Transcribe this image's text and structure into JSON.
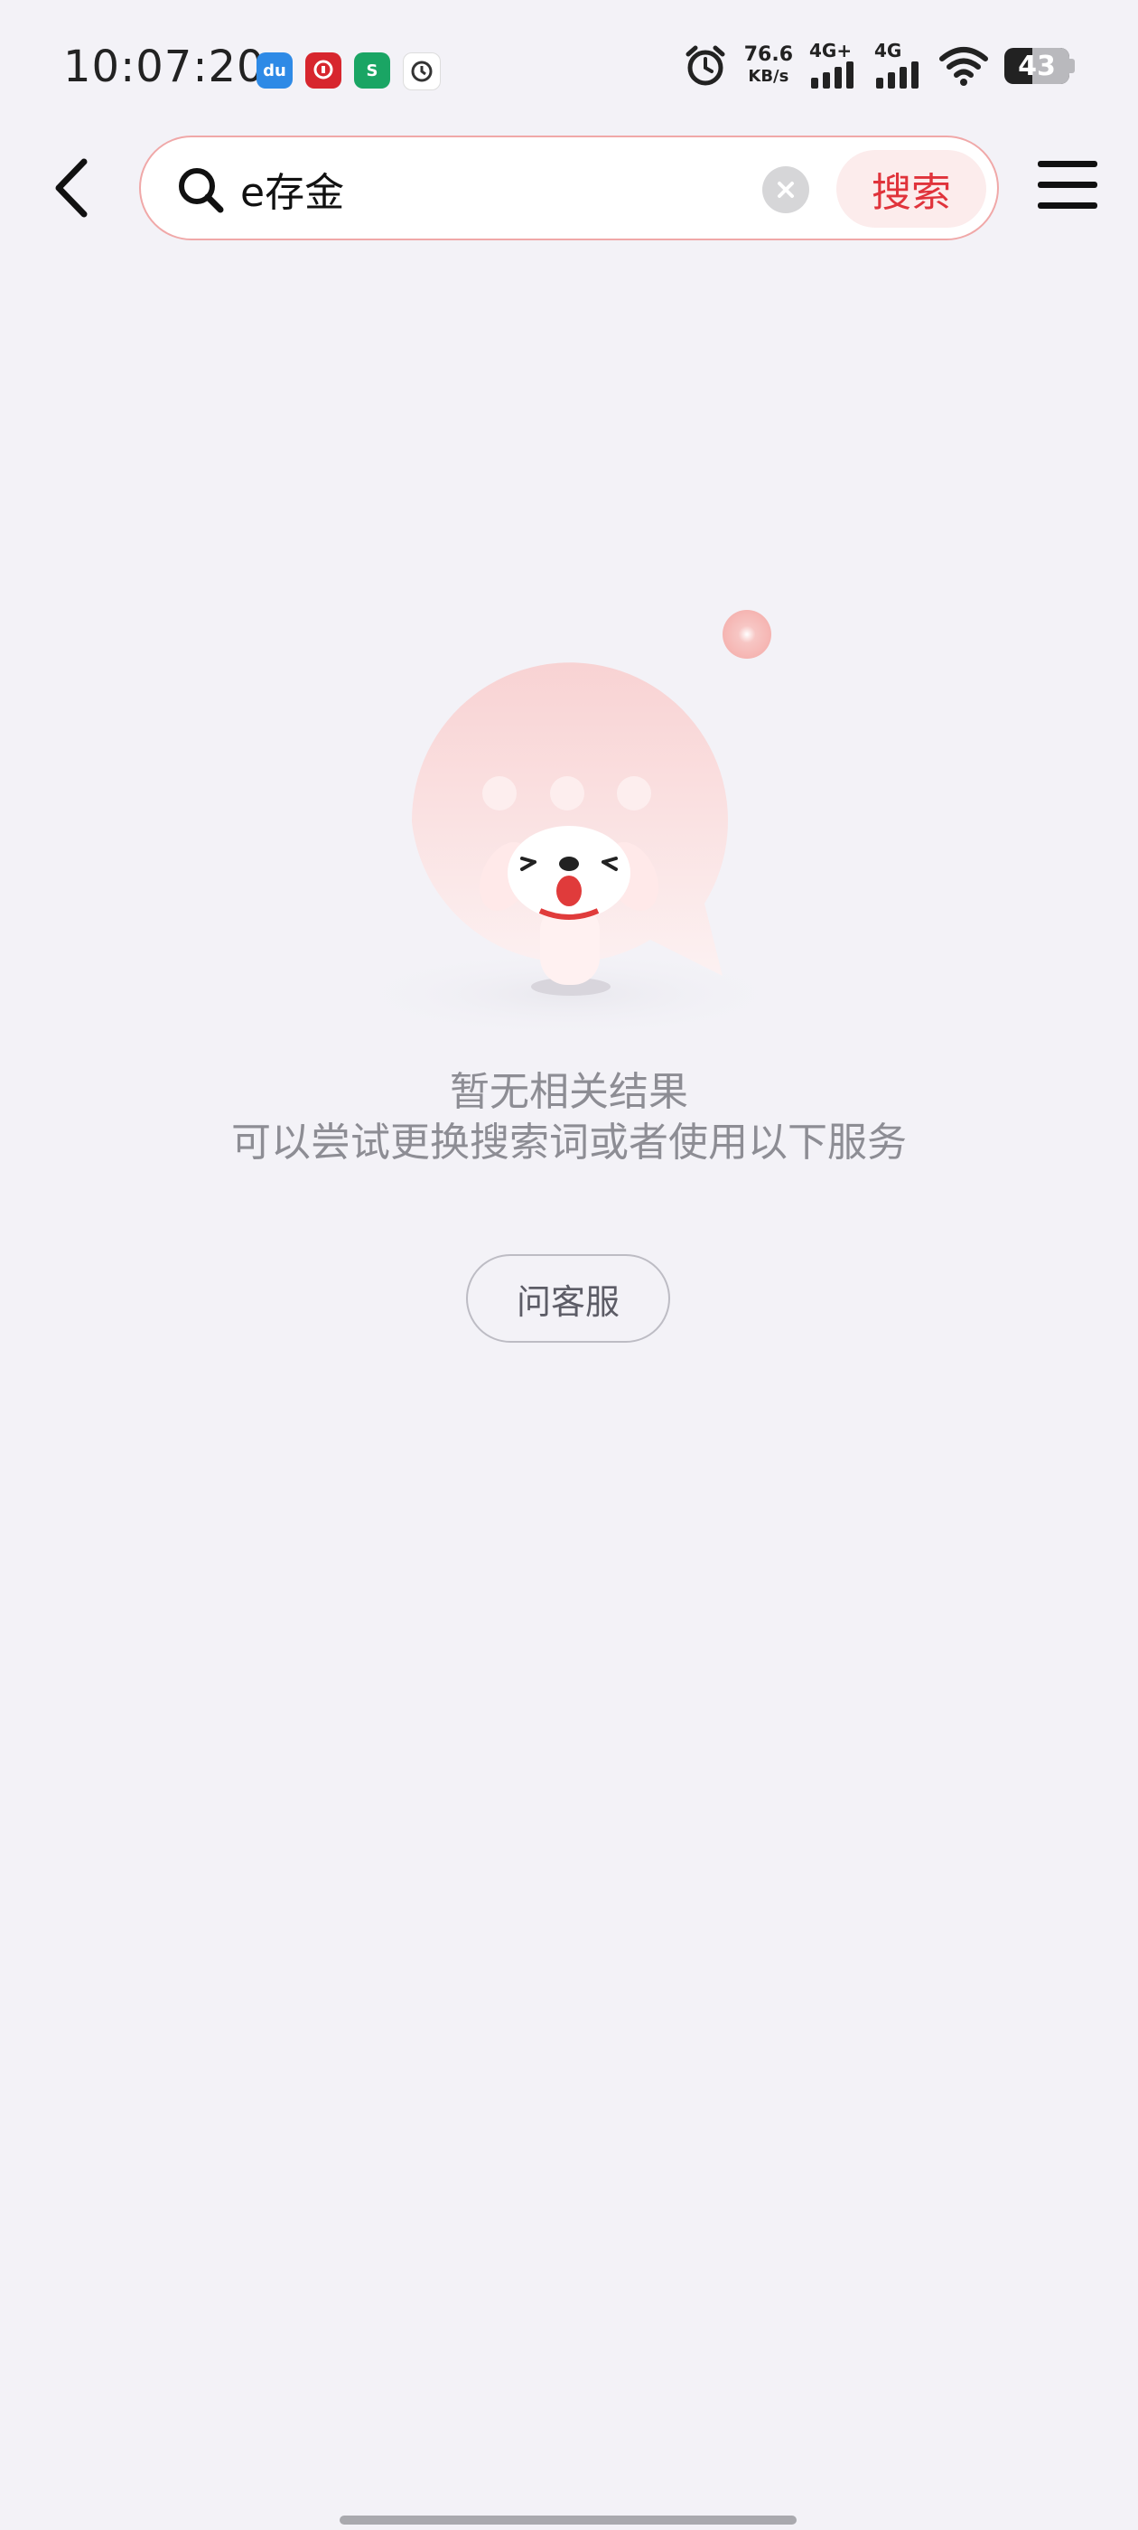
{
  "status_bar": {
    "time": "10:07:20",
    "app_icons": [
      {
        "name": "du-app-icon",
        "text": "du",
        "color": "#2e8ae6"
      },
      {
        "name": "bank-app-icon",
        "text": "",
        "color": "#d7262e"
      },
      {
        "name": "s-app-icon",
        "text": "S",
        "color": "#1aa564"
      },
      {
        "name": "clock-app-icon",
        "text": "",
        "color": "#ffffff"
      }
    ],
    "net_speed_value": "76.6",
    "net_speed_unit": "KB/s",
    "signal1_label": "4G+",
    "signal2_label": "4G",
    "battery_percent": "43",
    "battery_level": 0.43
  },
  "header": {
    "search_value": "e存金",
    "search_button_label": "搜索"
  },
  "empty_state": {
    "title": "暂无相关结果",
    "subtitle": "可以尝试更换搜索词或者使用以下服务",
    "service_button_label": "问客服"
  },
  "colors": {
    "accent": "#e0333b",
    "background": "#f3f2f7",
    "muted_text": "#8d8d94"
  }
}
